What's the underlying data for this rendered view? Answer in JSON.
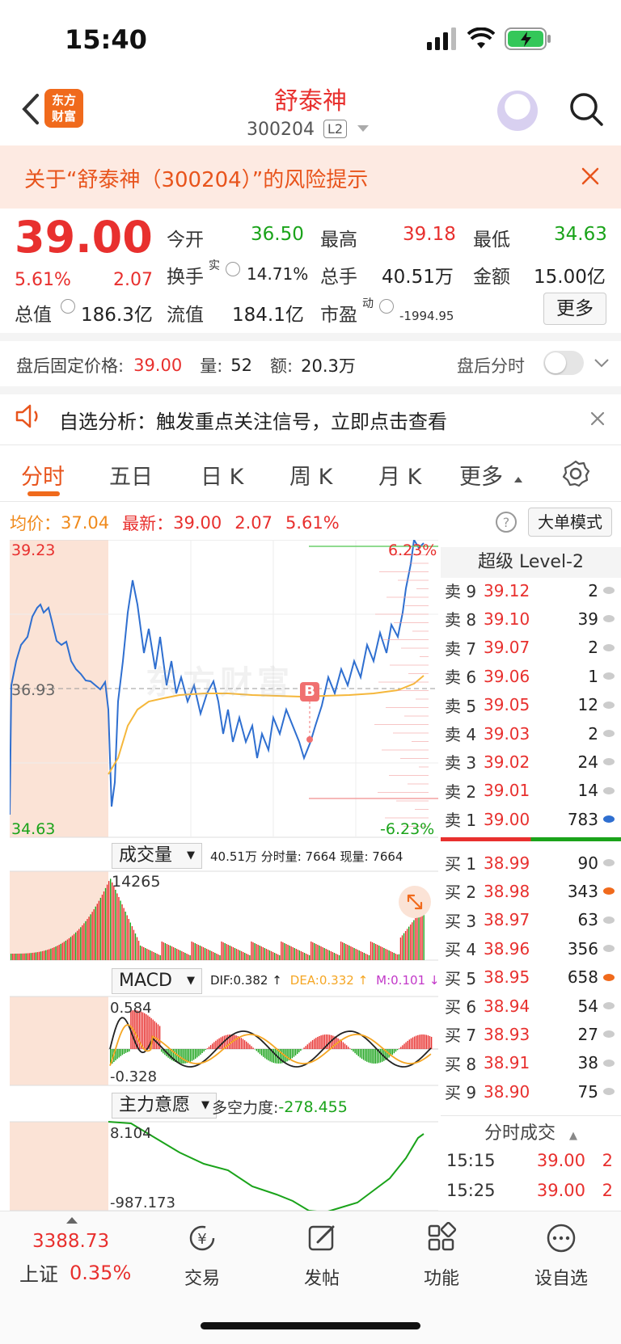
{
  "status": {
    "time": "15:40"
  },
  "header": {
    "logo_line1": "东方",
    "logo_line2": "财富",
    "stock_name": "舒泰神",
    "stock_code": "300204",
    "level_badge": "L2"
  },
  "risk_banner": {
    "text": "关于“舒泰神（300204）”的风险提示"
  },
  "quote": {
    "price": "39.00",
    "change_pct": "5.61%",
    "change_amt": "2.07",
    "open_label": "今开",
    "open": "36.50",
    "high_label": "最高",
    "high": "39.18",
    "low_label": "最低",
    "low": "34.63",
    "turnover_label": "换手",
    "turnover_sup": "实",
    "turnover": "14.71%",
    "volume_label": "总手",
    "volume": "40.51万",
    "amount_label": "金额",
    "amount": "15.00亿",
    "mktcap_label": "总值",
    "mktcap": "186.3亿",
    "float_label": "流值",
    "float": "184.1亿",
    "pe_label": "市盈",
    "pe_sup": "动",
    "pe": "-1994.95",
    "more_label": "更多"
  },
  "after_hours": {
    "price_label": "盘后固定价格:",
    "price": "39.00",
    "vol_label": "量:",
    "vol": "52",
    "amt_label": "额:",
    "amt": "20.3万",
    "toggle_label": "盘后分时"
  },
  "alert": {
    "text": "自选分析：触发重点关注信号，立即点击查看"
  },
  "tabs": [
    "分时",
    "五日",
    "日 K",
    "周 K",
    "月 K",
    "更多"
  ],
  "info_line": {
    "avg_label": "均价：",
    "avg": "37.04",
    "last_label": "最新：",
    "last": "39.00",
    "chg": "2.07",
    "pct": "5.61%",
    "mode_label": "大单模式"
  },
  "chart": {
    "price_high": "39.23",
    "price_mid": "36.93",
    "price_low": "34.63",
    "pct_high": "6.23%",
    "pct_low": "-6.23%",
    "b_marker": "B",
    "watermark": "东方财富",
    "vol_selector": "成交量",
    "vol_info": "40.51万 分时量: 7664 现量: 7664",
    "vol_max": "14265",
    "macd_selector": "MACD",
    "dif": "DIF:0.382 ↑",
    "dea": "DEA:0.332 ↑",
    "m": "M:0.101 ↓",
    "macd_top": "0.584",
    "macd_bottom": "-0.328",
    "zl_selector": "主力意愿",
    "zl_label": "多空力度:",
    "zl_value": "-278.455",
    "zl_top": "8.104",
    "zl_bottom": "-987.173"
  },
  "orderbook": {
    "title": "超级 Level-2",
    "asks": [
      {
        "label": "卖 9",
        "price": "39.12",
        "vol": "2"
      },
      {
        "label": "卖 8",
        "price": "39.10",
        "vol": "39"
      },
      {
        "label": "卖 7",
        "price": "39.07",
        "vol": "2"
      },
      {
        "label": "卖 6",
        "price": "39.06",
        "vol": "1"
      },
      {
        "label": "卖 5",
        "price": "39.05",
        "vol": "12"
      },
      {
        "label": "卖 4",
        "price": "39.03",
        "vol": "2"
      },
      {
        "label": "卖 3",
        "price": "39.02",
        "vol": "24"
      },
      {
        "label": "卖 2",
        "price": "39.01",
        "vol": "14"
      },
      {
        "label": "卖 1",
        "price": "39.00",
        "vol": "783"
      }
    ],
    "bids": [
      {
        "label": "买 1",
        "price": "38.99",
        "vol": "90"
      },
      {
        "label": "买 2",
        "price": "38.98",
        "vol": "343"
      },
      {
        "label": "买 3",
        "price": "38.97",
        "vol": "63"
      },
      {
        "label": "买 4",
        "price": "38.96",
        "vol": "356"
      },
      {
        "label": "买 5",
        "price": "38.95",
        "vol": "658"
      },
      {
        "label": "买 6",
        "price": "38.94",
        "vol": "54"
      },
      {
        "label": "买 7",
        "price": "38.93",
        "vol": "27"
      },
      {
        "label": "买 8",
        "price": "38.91",
        "vol": "38"
      },
      {
        "label": "买 9",
        "price": "38.90",
        "vol": "75"
      }
    ],
    "ts_title": "分时成交",
    "ticks": [
      {
        "time": "15:15",
        "price": "39.00",
        "vol": "2"
      },
      {
        "time": "15:25",
        "price": "39.00",
        "vol": "2"
      }
    ]
  },
  "bottom_nav": {
    "index_value": "3388.73",
    "index_name": "上证",
    "index_pct": "0.35%",
    "items": [
      "交易",
      "发帖",
      "功能",
      "设自选"
    ]
  },
  "colors": {
    "up": "#e8302e",
    "down": "#1aa31a",
    "accent": "#f06a1c",
    "avg_line": "#f5b73b",
    "price_line": "#2f6fd0"
  }
}
